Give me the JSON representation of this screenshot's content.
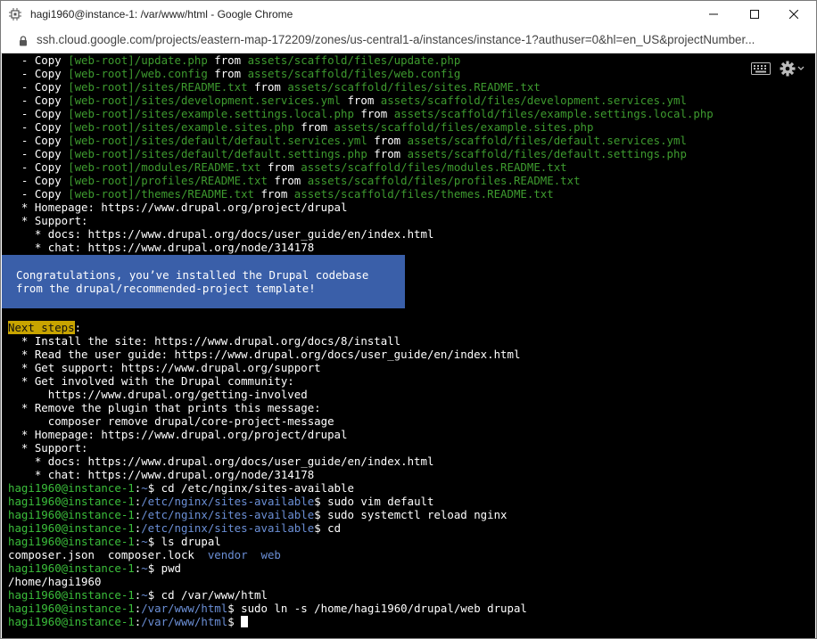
{
  "window": {
    "title": "hagi1960@instance-1: /var/www/html - Google Chrome",
    "url": "ssh.cloud.google.com/projects/eastern-map-172209/zones/us-central1-a/instances/instance-1?authuser=0&hl=en_US&projectNumber..."
  },
  "copy_lines": [
    {
      "src": "[web-root]/update.php",
      "dst": "assets/scaffold/files/update.php"
    },
    {
      "src": "[web-root]/web.config",
      "dst": "assets/scaffold/files/web.config"
    },
    {
      "src": "[web-root]/sites/README.txt",
      "dst": "assets/scaffold/files/sites.README.txt"
    },
    {
      "src": "[web-root]/sites/development.services.yml",
      "dst": "assets/scaffold/files/development.services.yml"
    },
    {
      "src": "[web-root]/sites/example.settings.local.php",
      "dst": "assets/scaffold/files/example.settings.local.php"
    },
    {
      "src": "[web-root]/sites/example.sites.php",
      "dst": "assets/scaffold/files/example.sites.php"
    },
    {
      "src": "[web-root]/sites/default/default.services.yml",
      "dst": "assets/scaffold/files/default.services.yml"
    },
    {
      "src": "[web-root]/sites/default/default.settings.php",
      "dst": "assets/scaffold/files/default.settings.php"
    },
    {
      "src": "[web-root]/modules/README.txt",
      "dst": "assets/scaffold/files/modules.README.txt"
    },
    {
      "src": "[web-root]/profiles/README.txt",
      "dst": "assets/scaffold/files/profiles.README.txt"
    },
    {
      "src": "[web-root]/themes/README.txt",
      "dst": "assets/scaffold/files/themes.README.txt"
    }
  ],
  "copy_prefix": "  - Copy ",
  "copy_from": " from ",
  "info1": [
    "  * Homepage: https://www.drupal.org/project/drupal",
    "  * Support:",
    "    * docs: https://www.drupal.org/docs/user_guide/en/index.html",
    "    * chat: https://www.drupal.org/node/314178"
  ],
  "banner": {
    "line1": "Congratulations, you’ve installed the Drupal codebase",
    "line2": "from the drupal/recommended-project template!"
  },
  "next_steps_label": "Next steps",
  "next_steps_colon": ":",
  "steps": [
    "  * Install the site: https://www.drupal.org/docs/8/install",
    "  * Read the user guide: https://www.drupal.org/docs/user_guide/en/index.html",
    "  * Get support: https://www.drupal.org/support",
    "  * Get involved with the Drupal community:",
    "      https://www.drupal.org/getting-involved",
    "  * Remove the plugin that prints this message:",
    "      composer remove drupal/core-project-message",
    "  * Homepage: https://www.drupal.org/project/drupal",
    "  * Support:",
    "    * docs: https://www.drupal.org/docs/user_guide/en/index.html",
    "    * chat: https://www.drupal.org/node/314178"
  ],
  "user_host": "hagi1960@instance-1",
  "sep": ":",
  "prompts": [
    {
      "path": "~",
      "cmd": "$ cd /etc/nginx/sites-available"
    },
    {
      "path": "/etc/nginx/sites-available",
      "cmd": "$ sudo vim default"
    },
    {
      "path": "/etc/nginx/sites-available",
      "cmd": "$ sudo systemctl reload nginx"
    },
    {
      "path": "/etc/nginx/sites-available",
      "cmd": "$ cd"
    },
    {
      "path": "~",
      "cmd": "$ ls drupal"
    }
  ],
  "ls_output": {
    "f1": "composer.json",
    "f2": "composer.lock",
    "d1": "vendor",
    "d2": "web"
  },
  "prompt_pwd": {
    "path": "~",
    "cmd": "$ pwd"
  },
  "pwd_output": "/home/hagi1960",
  "prompts2": [
    {
      "path": "~",
      "cmd": "$ cd /var/www/html"
    },
    {
      "path": "/var/www/html",
      "cmd": "$ sudo ln -s /home/hagi1960/drupal/web drupal"
    },
    {
      "path": "/var/www/html",
      "cmd": "$ "
    }
  ],
  "colors": {
    "prompt_user": "#3bbf3b",
    "path": "#6b8fd6",
    "copy_path": "#3e9b2f",
    "banner": "#3a5fa9",
    "highlight": "#c8a400"
  }
}
